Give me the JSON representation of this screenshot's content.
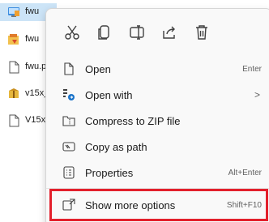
{
  "files": [
    {
      "name": "fwu",
      "icon": "installer-icon",
      "selected": true
    },
    {
      "name": "fwu",
      "icon": "archive-icon",
      "selected": false
    },
    {
      "name": "fwu.p",
      "icon": "document-icon",
      "selected": false
    },
    {
      "name": "v15x_",
      "icon": "package-icon",
      "selected": false
    },
    {
      "name": "V15x_",
      "icon": "document-icon",
      "selected": false
    }
  ],
  "toolbar": {
    "cut": "cut-icon",
    "copy": "copy-icon",
    "rename": "rename-icon",
    "share": "share-icon",
    "delete": "trash-icon"
  },
  "menu": {
    "open": {
      "label": "Open",
      "shortcut": "Enter"
    },
    "open_with": {
      "label": "Open with",
      "chevron": ">"
    },
    "compress": {
      "label": "Compress to ZIP file"
    },
    "copy_path": {
      "label": "Copy as path"
    },
    "properties": {
      "label": "Properties",
      "shortcut": "Alt+Enter"
    },
    "show_more": {
      "label": "Show more options",
      "shortcut": "Shift+F10"
    }
  },
  "colors": {
    "accent_blue": "#1a73c9",
    "selection": "#cce4f7",
    "highlight_red": "#e3202c"
  }
}
